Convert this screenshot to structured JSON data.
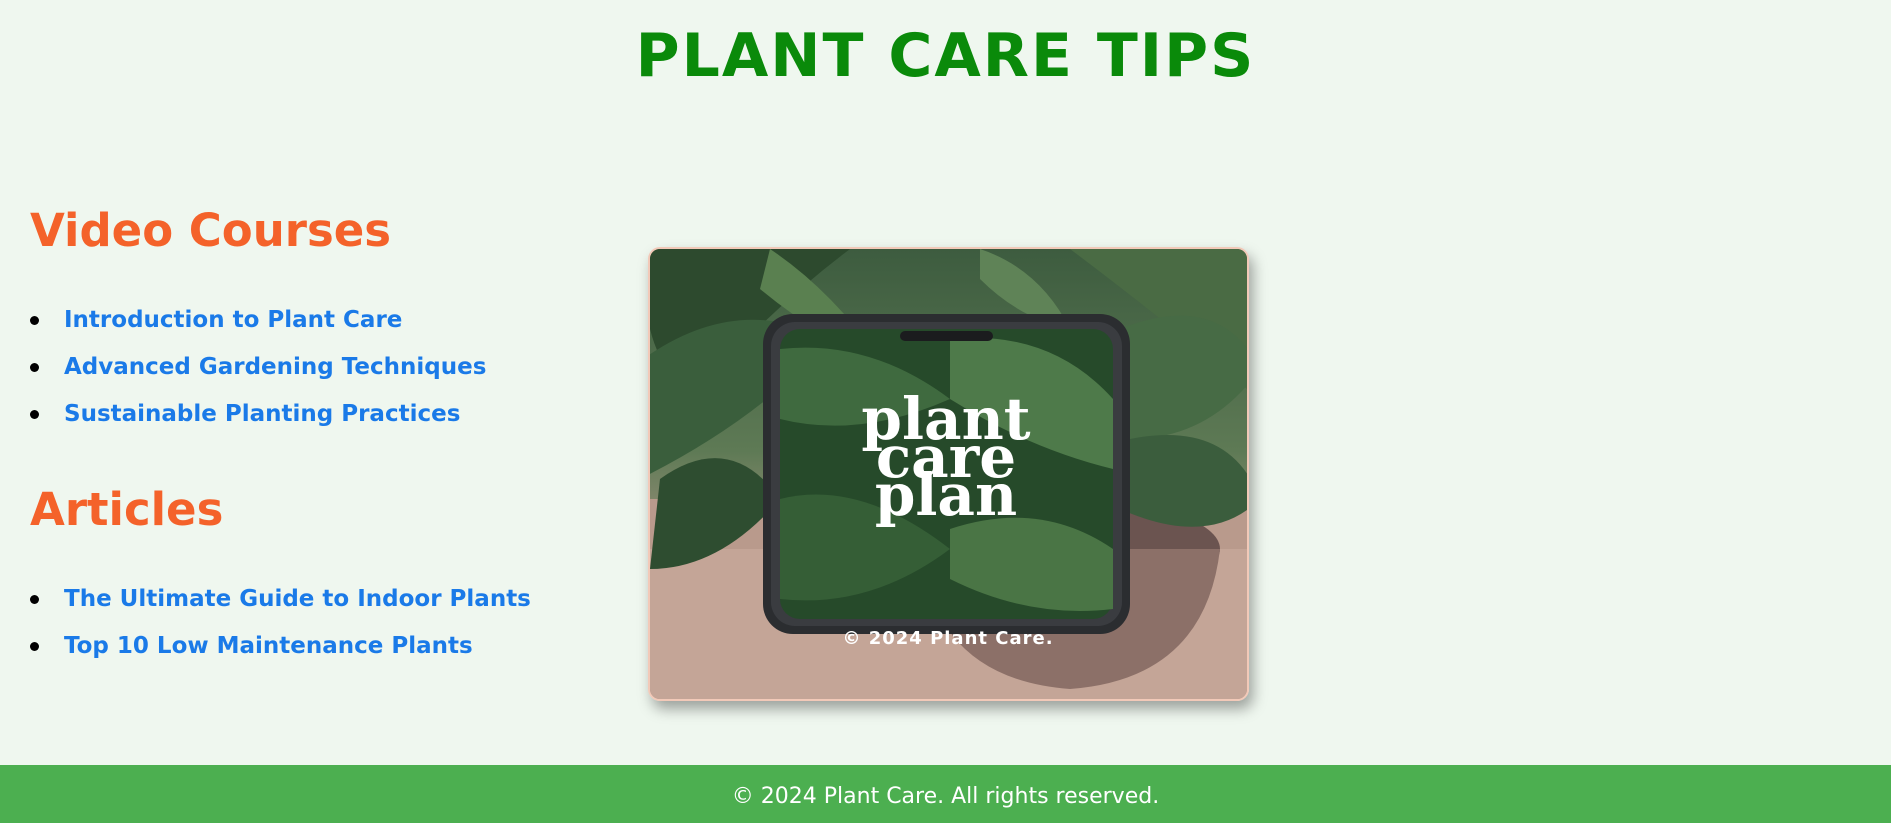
{
  "header": {
    "title": "PLANT CARE TIPS"
  },
  "video_courses": {
    "heading": "Video Courses",
    "links": [
      "Introduction to Plant Care",
      "Advanced Gardening Techniques",
      "Sustainable Planting Practices"
    ]
  },
  "articles": {
    "heading": "Articles",
    "links": [
      "The Ultimate Guide to Indoor Plants",
      "Top 10 Low Maintenance Plants"
    ]
  },
  "hero_image": {
    "phone_text_line1": "plant",
    "phone_text_line2": "care",
    "phone_text_line3": "plan",
    "caption": "© 2024 Plant Care."
  },
  "footer": {
    "text": "© 2024 Plant Care. All rights reserved."
  },
  "colors": {
    "title": "#0a8a0a",
    "section_heading": "#f4622a",
    "link": "#1a7ae8",
    "footer_bg": "#4caf50",
    "page_bg": "#eff7ef"
  }
}
